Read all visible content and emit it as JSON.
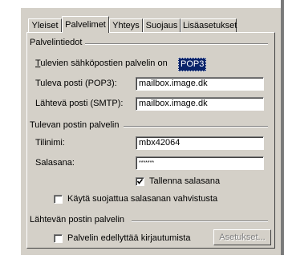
{
  "tabs": [
    {
      "label": "Yleiset",
      "active": false
    },
    {
      "label": "Palvelimet",
      "active": true
    },
    {
      "label": "Yhteys",
      "active": false
    },
    {
      "label": "Suojaus",
      "active": false
    },
    {
      "label": "Lisäasetukset",
      "active": false
    }
  ],
  "server_info": {
    "group_title": "Palvelintiedot",
    "incoming_type_label": "Tulevien sähköpostien palvelin on",
    "incoming_type_value": "POP3",
    "incoming_label": "Tuleva posti (POP3):",
    "incoming_value": "mailbox.image.dk",
    "outgoing_label": "Lähtevä posti (SMTP):",
    "outgoing_value": "mailbox.image.dk"
  },
  "incoming_server": {
    "group_title": "Tulevan postin palvelin",
    "account_label": "Tilinimi:",
    "account_value": "mbx42064",
    "password_label": "Salasana:",
    "password_value": "*******",
    "remember_password_label": "Tallenna salasana",
    "remember_password_checked": true,
    "secure_auth_label": "Käytä suojattua salasanan vahvistusta",
    "secure_auth_checked": false
  },
  "outgoing_server": {
    "group_title": "Lähtevän postin palvelin",
    "requires_auth_label": "Palvelin edellyttää kirjautumista",
    "requires_auth_checked": false,
    "settings_button_label": "Asetukset..."
  },
  "colors": {
    "dialog_face": "#d4d0c8",
    "selection": "#0a246a",
    "disabled_text": "#808080"
  }
}
